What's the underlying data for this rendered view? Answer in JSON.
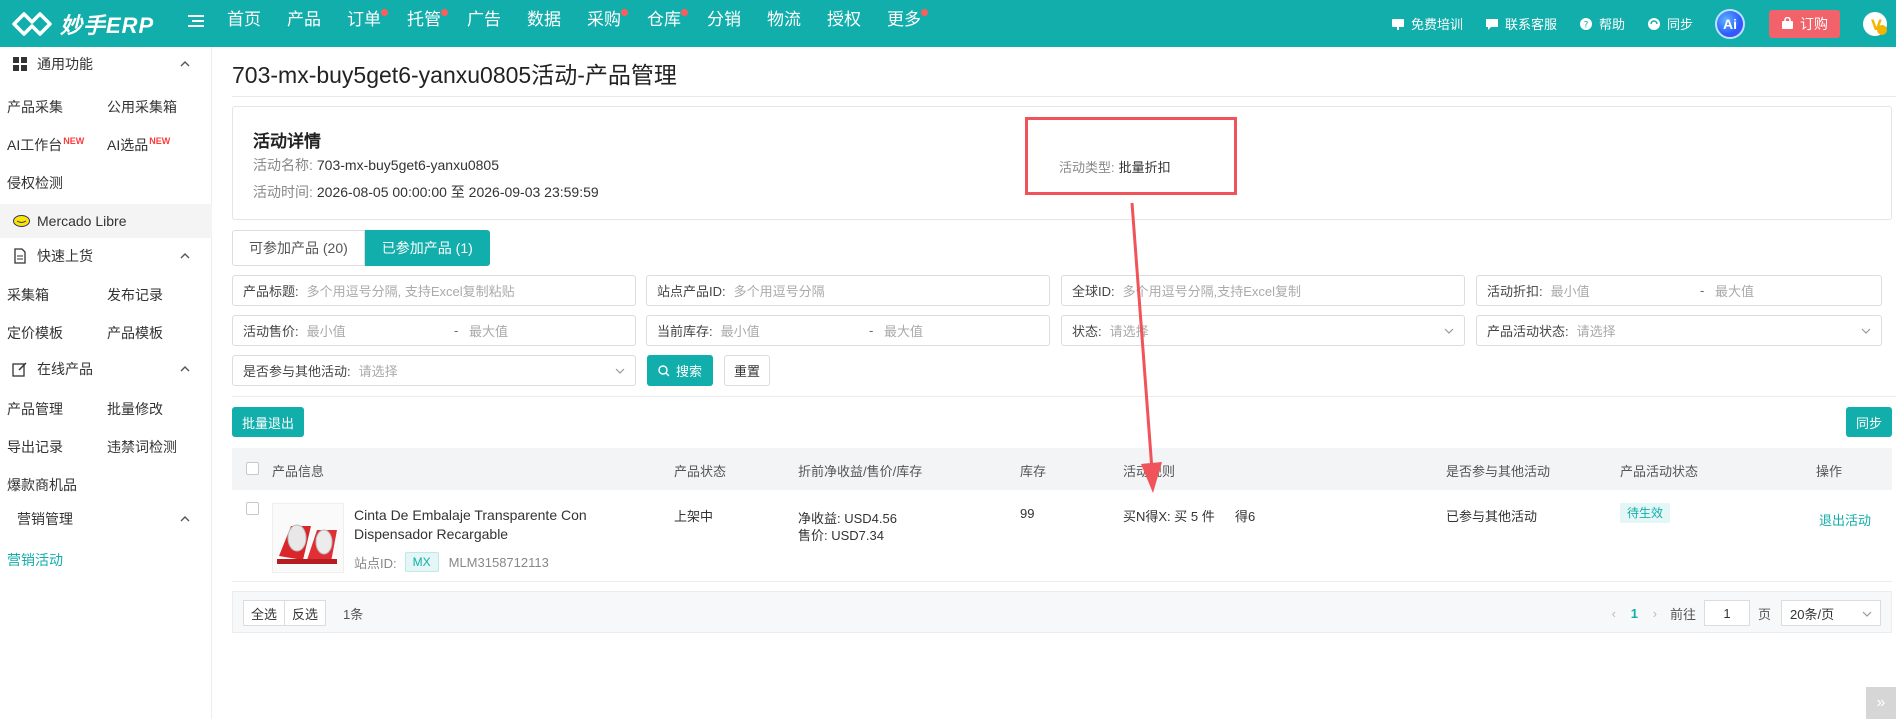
{
  "app": {
    "logo_text": "妙手ERP",
    "nav": [
      {
        "label": "首页",
        "dot": false
      },
      {
        "label": "产品",
        "dot": false
      },
      {
        "label": "订单",
        "dot": true
      },
      {
        "label": "托管",
        "dot": true
      },
      {
        "label": "广告",
        "dot": false
      },
      {
        "label": "数据",
        "dot": false
      },
      {
        "label": "采购",
        "dot": true
      },
      {
        "label": "仓库",
        "dot": true
      },
      {
        "label": "分销",
        "dot": false
      },
      {
        "label": "物流",
        "dot": false
      },
      {
        "label": "授权",
        "dot": false
      },
      {
        "label": "更多",
        "dot": true
      }
    ],
    "top_right": {
      "training": "免费培训",
      "support": "联系客服",
      "help": "帮助",
      "sync": "同步",
      "ai_badge": "Ai",
      "order": "订购"
    },
    "colors": {
      "primary": "#12aeab",
      "danger": "#f0535a",
      "order_btn": "#f2626a"
    }
  },
  "sidebar": {
    "general": {
      "title": "通用功能",
      "items": [
        "产品采集",
        "公用采集箱",
        "AI工作台",
        "AI选品",
        "侵权检测"
      ],
      "new_badge": "NEW"
    },
    "platform": "Mercado Libre",
    "quick": {
      "title": "快速上货",
      "items": [
        "采集箱",
        "发布记录",
        "定价模板",
        "产品模板"
      ]
    },
    "online": {
      "title": "在线产品",
      "items": [
        "产品管理",
        "批量修改",
        "导出记录",
        "违禁词检测",
        "爆款商机品"
      ]
    },
    "marketing": {
      "title": "营销管理",
      "items": [
        "营销活动"
      ]
    }
  },
  "page": {
    "title": "703-mx-buy5get6-yanxu0805活动-产品管理",
    "detail": {
      "heading": "活动详情",
      "name_label": "活动名称:",
      "name_value": "703-mx-buy5get6-yanxu0805",
      "time_label": "活动时间:",
      "time_value": "2026-08-05 00:00:00 至 2026-09-03 23:59:59",
      "type_label": "活动类型:",
      "type_value": "批量折扣"
    },
    "tabs": [
      "可参加产品 (20)",
      "已参加产品 (1)"
    ],
    "filters": {
      "title_label": "产品标题:",
      "title_ph": "多个用逗号分隔, 支持Excel复制粘贴",
      "site_id_label": "站点产品ID:",
      "site_id_ph": "多个用逗号分隔",
      "global_id_label": "全球ID:",
      "global_id_ph": "多个用逗号分隔,支持Excel复制",
      "discount_label": "活动折扣:",
      "min_ph": "最小值",
      "max_ph": "最大值",
      "dash": "-",
      "price_label": "活动售价:",
      "stock_label": "当前库存:",
      "status_label": "状态:",
      "select_ph": "请选择",
      "act_status_label": "产品活动状态:",
      "other_label": "是否参与其他活动:"
    },
    "search_btn": "搜索",
    "reset_btn": "重置",
    "batch_exit": "批量退出",
    "sync_btn": "同步",
    "table": {
      "headers": [
        "产品信息",
        "产品状态",
        "折前净收益/售价/库存",
        "库存",
        "活动规则",
        "是否参与其他活动",
        "产品活动状态",
        "操作"
      ],
      "rows": [
        {
          "title": "Cinta De Embalaje Transparente Con Dispensador Recargable",
          "site_label": "站点ID:",
          "site_tag": "MX",
          "site_id": "MLM3158712113",
          "status": "上架中",
          "net_income": "净收益: USD4.56",
          "price": "售价: USD7.34",
          "stock": "99",
          "rule": "买N得X: 买 5 件 　 得6",
          "other": "已参与其他活动",
          "act_status": "待生效",
          "action": "退出活动"
        }
      ]
    },
    "footer": {
      "select_all": "全选",
      "invert": "反选",
      "count": "1条",
      "current_page": "1",
      "goto_label": "前往",
      "goto_value": "1",
      "page_unit": "页",
      "page_size": "20条/页"
    }
  }
}
